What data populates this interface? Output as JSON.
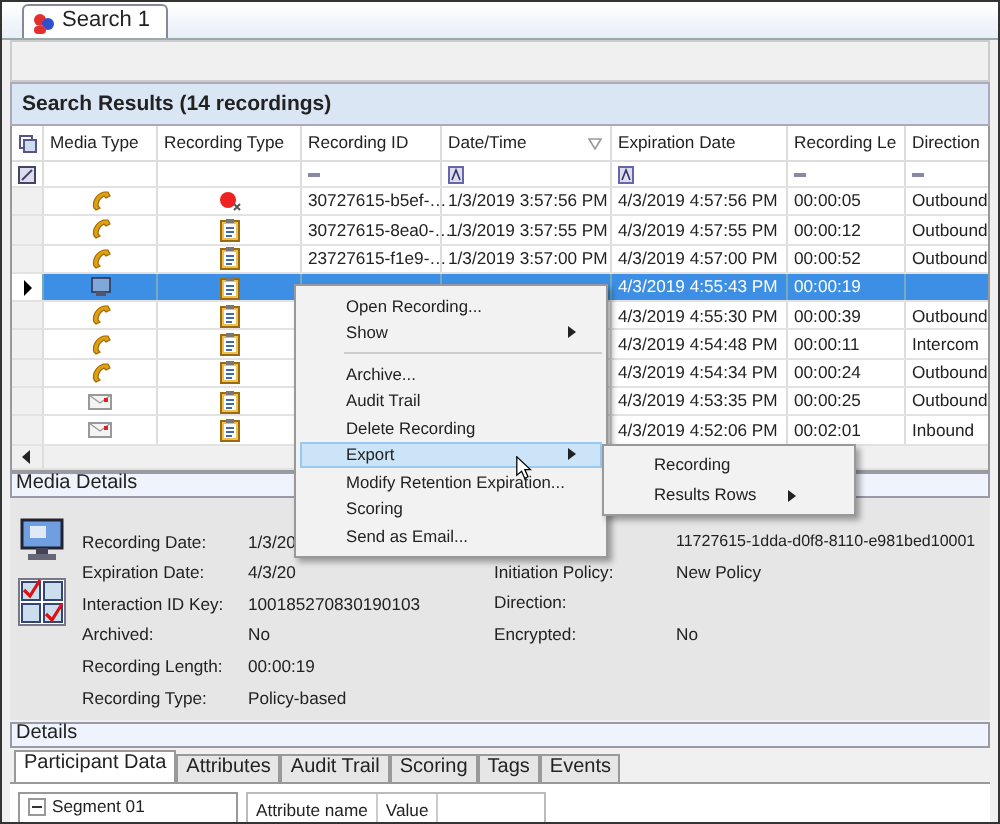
{
  "tab": {
    "label": "Search 1",
    "selected": true
  },
  "results": {
    "title": "Search Results (14 recordings)",
    "columns": [
      "Media Type",
      "Recording Type",
      "Recording ID",
      "Date/Time",
      "Expiration Date",
      "Recording Le",
      "Direction"
    ],
    "rows": [
      {
        "selected": false,
        "media": {
          "kind": "phone"
        },
        "recording_type": {
          "kind": "record"
        },
        "recording_id": "30727615-b5ef-…",
        "date_time": "1/3/2019 3:57:56 PM",
        "expiration": "4/3/2019 4:57:56 PM",
        "length": "00:00:05",
        "direction": "Outbound"
      },
      {
        "selected": false,
        "media": {
          "kind": "phone"
        },
        "recording_type": {
          "kind": "clipboard"
        },
        "recording_id": "30727615-8ea0-…",
        "date_time": "1/3/2019 3:57:55 PM",
        "expiration": "4/3/2019 4:57:55 PM",
        "length": "00:00:12",
        "direction": "Outbound"
      },
      {
        "selected": false,
        "media": {
          "kind": "phone"
        },
        "recording_type": {
          "kind": "clipboard"
        },
        "recording_id": "23727615-f1e9-…",
        "date_time": "1/3/2019 3:57:00 PM",
        "expiration": "4/3/2019 4:57:00 PM",
        "length": "00:00:52",
        "direction": "Outbound"
      },
      {
        "selected": true,
        "media": {
          "kind": "screen"
        },
        "recording_type": {
          "kind": "clipboard"
        },
        "expiration": "4/3/2019 4:55:43 PM",
        "length": "00:00:19"
      },
      {
        "selected": false,
        "media": {
          "kind": "phone"
        },
        "recording_type": {
          "kind": "clipboard"
        },
        "expiration": "4/3/2019 4:55:30 PM",
        "length": "00:00:39",
        "direction": "Outbound"
      },
      {
        "selected": false,
        "media": {
          "kind": "phone"
        },
        "recording_type": {
          "kind": "clipboard"
        },
        "expiration": "4/3/2019 4:54:48 PM",
        "length": "00:00:11",
        "direction": "Intercom"
      },
      {
        "selected": false,
        "media": {
          "kind": "phone"
        },
        "recording_type": {
          "kind": "clipboard"
        },
        "expiration": "4/3/2019 4:54:34 PM",
        "length": "00:00:24",
        "direction": "Outbound"
      },
      {
        "selected": false,
        "media": {
          "kind": "email"
        },
        "recording_type": {
          "kind": "clipboard"
        },
        "expiration": "4/3/2019 4:53:35 PM",
        "length": "00:00:25",
        "direction": "Outbound"
      },
      {
        "selected": false,
        "media": {
          "kind": "email"
        },
        "recording_type": {
          "kind": "clipboard"
        },
        "expiration": "4/3/2019 4:52:06 PM",
        "length": "00:02:01",
        "direction": "Inbound"
      }
    ]
  },
  "media_details": {
    "title": "Media Details",
    "left_fields": [
      {
        "label": "Recording Date:",
        "value": "1/3/20"
      },
      {
        "label": "Expiration Date:",
        "value": "4/3/20"
      },
      {
        "label": "Interaction ID Key:",
        "value": "100185270830190103"
      },
      {
        "label": "Archived:",
        "value": "No"
      },
      {
        "label": "Recording Length:",
        "value": "00:00:19"
      },
      {
        "label": "Recording Type:",
        "value": "Policy-based"
      }
    ],
    "right_fields": [
      {
        "value": "11727615-1dda-d0f8-8110-e981bed10001"
      },
      {
        "label": "Initiation Policy:",
        "value": "New Policy"
      },
      {
        "label": "Direction:"
      },
      {
        "label": "Encrypted:",
        "value": "No"
      }
    ]
  },
  "details": {
    "title": "Details",
    "tabs": [
      {
        "label": "Participant Data",
        "selected": true
      },
      {
        "label": "Attributes",
        "selected": false
      },
      {
        "label": "Audit Trail",
        "selected": false
      },
      {
        "label": "Scoring",
        "selected": false
      },
      {
        "label": "Tags",
        "selected": false
      },
      {
        "label": "Events",
        "selected": false
      }
    ],
    "tree": [
      {
        "label": "Segment 01",
        "expanded": true
      }
    ],
    "grid_columns": [
      "Attribute name",
      "Value"
    ]
  },
  "context_menu": {
    "items": [
      {
        "kind": "item",
        "label": "Open Recording...",
        "has_submenu": false,
        "highlighted": false
      },
      {
        "kind": "item",
        "label": "Show",
        "has_submenu": true,
        "highlighted": false
      },
      {
        "kind": "separator"
      },
      {
        "kind": "item",
        "label": "Archive...",
        "has_submenu": false,
        "highlighted": false
      },
      {
        "kind": "item",
        "label": "Audit Trail",
        "has_submenu": false,
        "highlighted": false
      },
      {
        "kind": "item",
        "label": "Delete Recording",
        "has_submenu": false,
        "highlighted": false
      },
      {
        "kind": "item",
        "label": "Export",
        "has_submenu": true,
        "highlighted": true
      },
      {
        "kind": "item",
        "label": "Modify Retention Expiration...",
        "has_submenu": false,
        "highlighted": false
      },
      {
        "kind": "item",
        "label": "Scoring",
        "has_submenu": false,
        "highlighted": false
      },
      {
        "kind": "item",
        "label": "Send as Email...",
        "has_submenu": false,
        "highlighted": false
      }
    ],
    "submenu": [
      {
        "label": "Recording",
        "has_submenu": false,
        "highlighted": false
      },
      {
        "label": "Results Rows",
        "has_submenu": true,
        "highlighted": false
      }
    ]
  }
}
